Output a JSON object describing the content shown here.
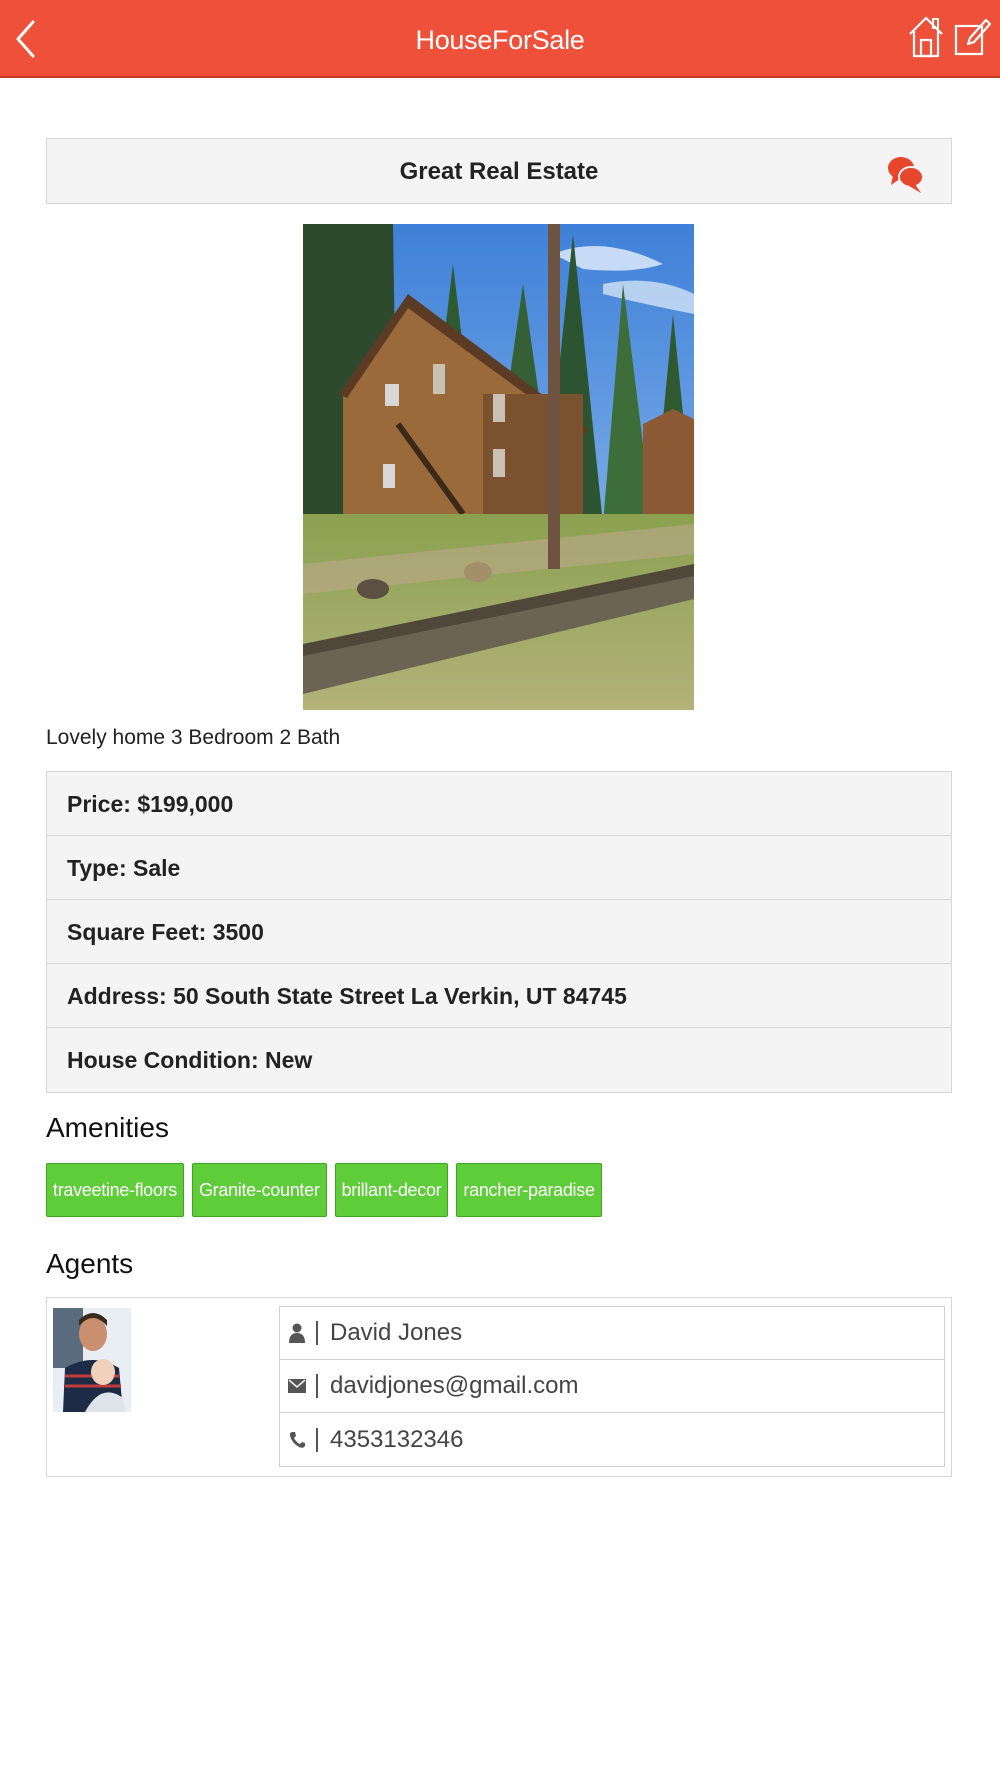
{
  "header": {
    "title": "HouseForSale",
    "back_icon": "chevron-left-icon",
    "home_icon": "home-icon",
    "edit_icon": "edit-icon",
    "background_color": "#ee5039"
  },
  "listing": {
    "title": "Great Real Estate",
    "chat_icon": "chat-bubbles-icon",
    "description": "Lovely home 3 Bedroom 2 Bath",
    "carousel": {
      "image_count": 2,
      "active_index": 0
    },
    "details": [
      {
        "label": "Price: $199,000"
      },
      {
        "label": "Type: Sale"
      },
      {
        "label": "Square Feet: 3500"
      },
      {
        "label": "Address: 50 South State Street La Verkin, UT 84745"
      },
      {
        "label": "House Condition: New"
      }
    ]
  },
  "amenities": {
    "heading": "Amenities",
    "tags": [
      "traveetine-floors",
      "Granite-counter",
      "brillant-decor",
      "rancher-paradise"
    ],
    "tag_color": "#5fcc3a"
  },
  "agents": {
    "heading": "Agents",
    "items": [
      {
        "name": "David Jones",
        "email": "davidjones@gmail.com",
        "phone": "4353132346"
      }
    ]
  }
}
